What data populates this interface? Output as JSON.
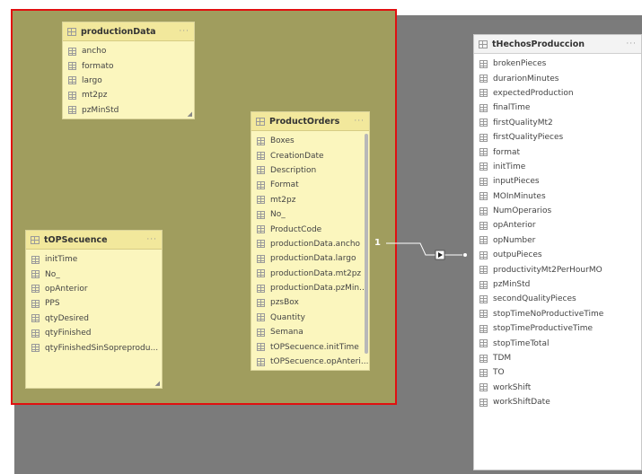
{
  "tables": {
    "productionData": {
      "title": "productionData",
      "more": "···",
      "fields": [
        "ancho",
        "formato",
        "largo",
        "mt2pz",
        "pzMinStd"
      ]
    },
    "productOrders": {
      "title": "ProductOrders",
      "more": "···",
      "fields": [
        "Boxes",
        "CreationDate",
        "Description",
        "Format",
        "mt2pz",
        "No_",
        "ProductCode",
        "productionData.ancho",
        "productionData.largo",
        "productionData.mt2pz",
        "productionData.pzMin...",
        "pzsBox",
        "Quantity",
        "Semana",
        "tOPSecuence.initTime",
        "tOPSecuence.opAnteri..."
      ]
    },
    "tOPSecuence": {
      "title": "tOPSecuence",
      "more": "···",
      "fields": [
        "initTime",
        "No_",
        "opAnterior",
        "PPS",
        "qtyDesired",
        "qtyFinished",
        "qtyFinishedSinSopreprodu..."
      ]
    },
    "tHechosProduccion": {
      "title": "tHechosProduccion",
      "more": "···",
      "fields": [
        "brokenPieces",
        "durarionMinutes",
        "expectedProduction",
        "finalTime",
        "firstQualityMt2",
        "firstQualityPieces",
        "format",
        "initTime",
        "inputPieces",
        "MOInMinutes",
        "NumOperarios",
        "opAnterior",
        "opNumber",
        "outpuPieces",
        "productivityMt2PerHourMO",
        "pzMinStd",
        "secondQualityPieces",
        "stopTimeNoProductiveTime",
        "stopTimeProductiveTime",
        "stopTimeTotal",
        "TDM",
        "TO",
        "workShift",
        "workShiftDate"
      ]
    }
  },
  "relationship": {
    "cardinality_from": "1"
  },
  "colors": {
    "group_fill": "#a09d5e",
    "selection_border": "#e01010",
    "canvas_gray": "#7b7b7b",
    "table_yellow": "#fbf6be"
  }
}
